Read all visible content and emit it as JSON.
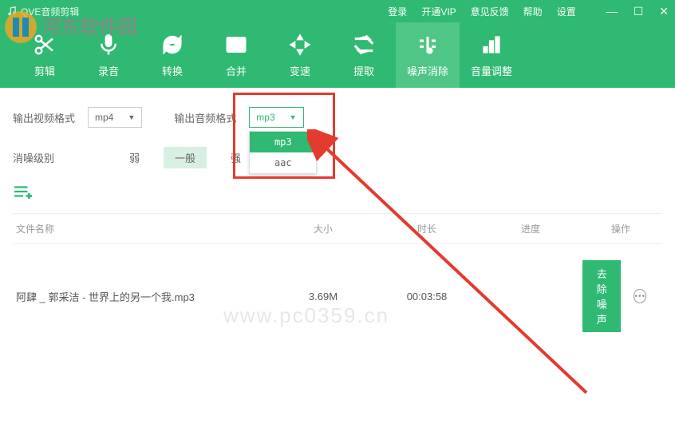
{
  "app_title": "QVE音频剪辑",
  "top_links": {
    "login": "登录",
    "vip": "开通VIP",
    "feedback": "意见反馈",
    "help": "帮助",
    "settings": "设置"
  },
  "tabs": [
    {
      "label": "剪辑"
    },
    {
      "label": "录音"
    },
    {
      "label": "转换"
    },
    {
      "label": "合并"
    },
    {
      "label": "变速"
    },
    {
      "label": "提取"
    },
    {
      "label": "噪声消除"
    },
    {
      "label": "音量调整"
    }
  ],
  "row1": {
    "video_fmt_label": "输出视频格式",
    "video_fmt_value": "mp4",
    "audio_fmt_label": "输出音频格式",
    "audio_fmt_value": "mp3"
  },
  "dropdown": {
    "opt1": "mp3",
    "opt2": "aac"
  },
  "row2": {
    "denoise_label": "消噪级别",
    "weak": "弱",
    "normal": "一般",
    "strong": "强"
  },
  "table": {
    "h_name": "文件名称",
    "h_size": "大小",
    "h_dur": "时长",
    "h_prog": "进度",
    "h_op": "操作"
  },
  "file": {
    "name": "阿肆 _ 郭采洁 - 世界上的另一个我.mp3",
    "size": "3.69M",
    "duration": "00:03:58",
    "action": "去除噪声"
  },
  "watermark_site": "河东软件园",
  "watermark_url": "www.pc0359.cn"
}
